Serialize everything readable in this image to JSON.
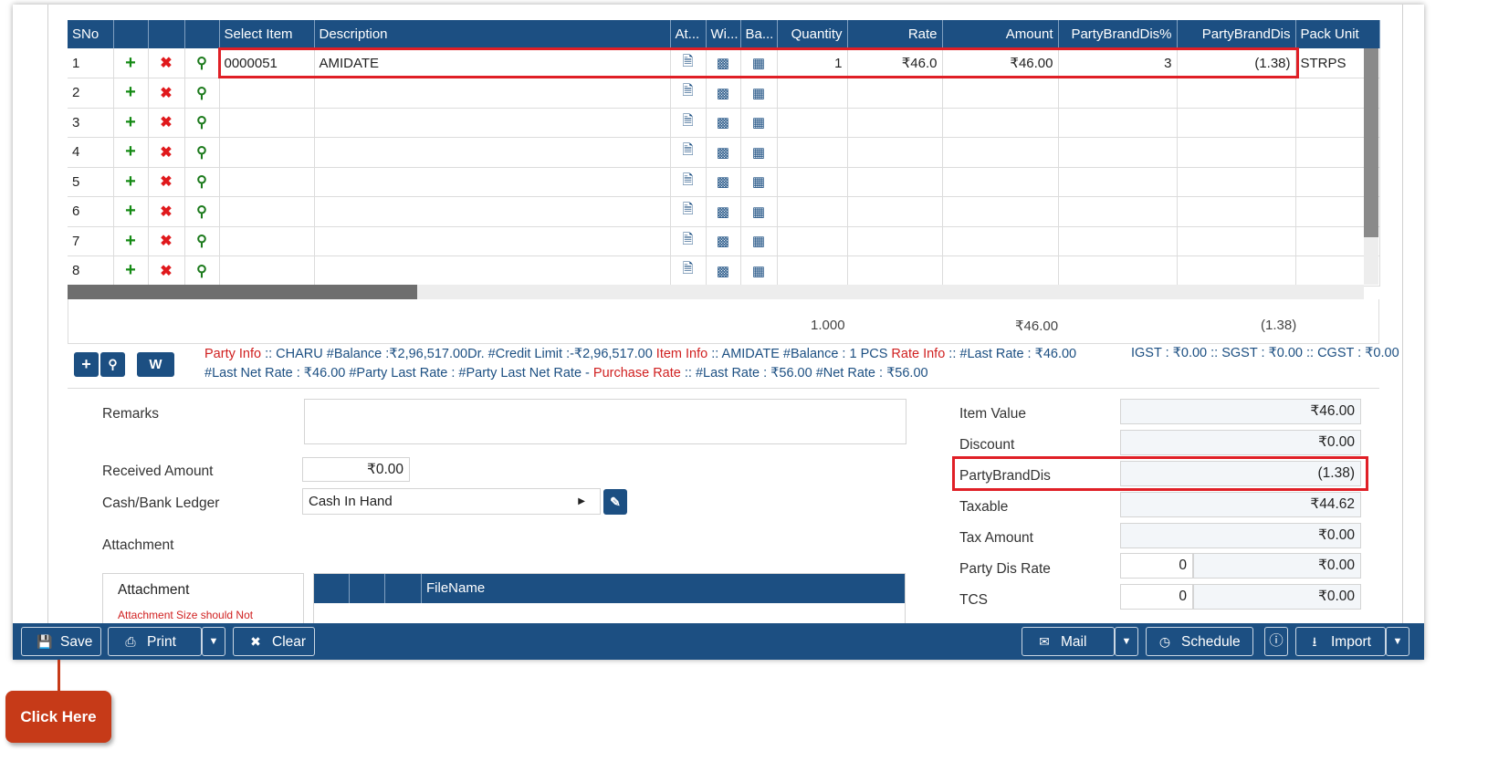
{
  "grid": {
    "headers": [
      "SNo",
      "",
      "",
      "",
      "Select Item",
      "Description",
      "At...",
      "Wi...",
      "Ba...",
      "Quantity",
      "Rate",
      "Amount",
      "PartyBrandDis%",
      "PartyBrandDis",
      "Pack Unit"
    ],
    "rows": [
      {
        "sno": "1",
        "item": "0000051",
        "desc": "AMIDATE",
        "qty": "1",
        "rate": "₹46.0",
        "amount": "₹46.00",
        "dis_pct": "3",
        "dis": "(1.38)",
        "unit": "STRPS"
      },
      {
        "sno": "2",
        "item": "",
        "desc": "",
        "qty": "",
        "rate": "",
        "amount": "",
        "dis_pct": "",
        "dis": "",
        "unit": ""
      },
      {
        "sno": "3",
        "item": "",
        "desc": "",
        "qty": "",
        "rate": "",
        "amount": "",
        "dis_pct": "",
        "dis": "",
        "unit": ""
      },
      {
        "sno": "4",
        "item": "",
        "desc": "",
        "qty": "",
        "rate": "",
        "amount": "",
        "dis_pct": "",
        "dis": "",
        "unit": ""
      },
      {
        "sno": "5",
        "item": "",
        "desc": "",
        "qty": "",
        "rate": "",
        "amount": "",
        "dis_pct": "",
        "dis": "",
        "unit": ""
      },
      {
        "sno": "6",
        "item": "",
        "desc": "",
        "qty": "",
        "rate": "",
        "amount": "",
        "dis_pct": "",
        "dis": "",
        "unit": ""
      },
      {
        "sno": "7",
        "item": "",
        "desc": "",
        "qty": "",
        "rate": "",
        "amount": "",
        "dis_pct": "",
        "dis": "",
        "unit": ""
      },
      {
        "sno": "8",
        "item": "",
        "desc": "",
        "qty": "",
        "rate": "",
        "amount": "",
        "dis_pct": "",
        "dis": "",
        "unit": ""
      }
    ],
    "totals": {
      "qty": "1.000",
      "amount": "₹46.00",
      "dis": "(1.38)"
    }
  },
  "actions": {
    "w_label": "W"
  },
  "info": {
    "party_label": "Party Info",
    "party_text": " :: CHARU #Balance :₹2,96,517.00Dr. #Credit Limit :-₹2,96,517.00 ",
    "item_label": "Item Info",
    "item_text": " :: AMIDATE #Balance : 1 PCS ",
    "rate_label": "Rate Info",
    "rate_text": " :: #Last Rate : ₹46.00",
    "line2_text": "#Last Net Rate : ₹46.00 #Party Last Rate : #Party Last Net Rate - ",
    "purchase_label": "Purchase Rate",
    "purchase_text": " :: #Last Rate : ₹56.00 #Net Rate : ₹56.00",
    "tax": "IGST : ₹0.00 :: SGST : ₹0.00 :: CGST : ₹0.00"
  },
  "form": {
    "remarks_label": "Remarks",
    "received_label": "Received Amount",
    "received_value": "₹0.00",
    "ledger_label": "Cash/Bank Ledger",
    "ledger_value": "Cash In Hand",
    "attachment_label": "Attachment",
    "attachment_tab": "Attachment",
    "attachment_note": "Attachment Size should Not",
    "filename_header": "FileName"
  },
  "summary": {
    "item_value_label": "Item Value",
    "item_value": "₹46.00",
    "discount_label": "Discount",
    "discount": "₹0.00",
    "pbd_label": "PartyBrandDis",
    "pbd": "(1.38)",
    "taxable_label": "Taxable",
    "taxable": "₹44.62",
    "tax_amount_label": "Tax Amount",
    "tax_amount": "₹0.00",
    "party_dis_label": "Party Dis Rate",
    "party_dis_rate": "0",
    "party_dis_amount": "₹0.00",
    "tcs_label": "TCS",
    "tcs_rate": "0",
    "tcs_amount": "₹0.00"
  },
  "toolbar": {
    "save": "Save",
    "print": "Print",
    "clear": "Clear",
    "mail": "Mail",
    "schedule": "Schedule",
    "import": "Import"
  },
  "callout": "Click Here"
}
